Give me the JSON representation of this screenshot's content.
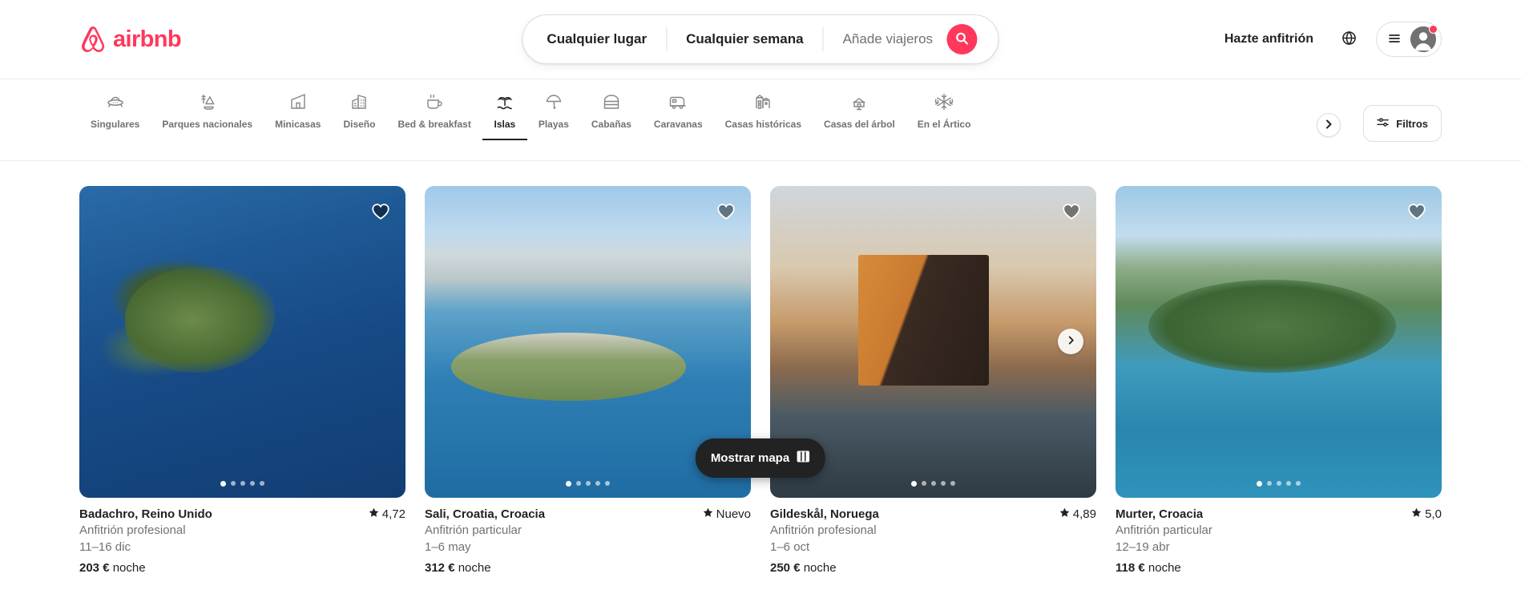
{
  "brand": {
    "name": "airbnb",
    "color": "#FF385C"
  },
  "search": {
    "place_label": "Cualquier lugar",
    "date_label": "Cualquier semana",
    "guests_placeholder": "Añade viajeros",
    "guests_value": "",
    "search_icon": "search-icon"
  },
  "header": {
    "host_link": "Hazte anfitrión",
    "globe_icon": "globe-icon",
    "menu_icon": "hamburger-menu-icon",
    "avatar_icon": "user-avatar-icon",
    "has_notification": true
  },
  "categories": {
    "items": [
      {
        "label": "Singulares",
        "icon": "ufo-icon",
        "active": false
      },
      {
        "label": "Parques nacionales",
        "icon": "national-park-icon",
        "active": false
      },
      {
        "label": "Minicasas",
        "icon": "tiny-house-icon",
        "active": false
      },
      {
        "label": "Diseño",
        "icon": "design-house-icon",
        "active": false
      },
      {
        "label": "Bed & breakfast",
        "icon": "coffee-cup-icon",
        "active": false
      },
      {
        "label": "Islas",
        "icon": "island-palm-icon",
        "active": true
      },
      {
        "label": "Playas",
        "icon": "beach-umbrella-icon",
        "active": false
      },
      {
        "label": "Cabañas",
        "icon": "cabin-icon",
        "active": false
      },
      {
        "label": "Caravanas",
        "icon": "camper-van-icon",
        "active": false
      },
      {
        "label": "Casas históricas",
        "icon": "historic-house-icon",
        "active": false
      },
      {
        "label": "Casas del árbol",
        "icon": "treehouse-icon",
        "active": false
      },
      {
        "label": "En el Ártico",
        "icon": "snowflake-icon",
        "active": false
      }
    ],
    "next_arrow_icon": "chevron-right-icon",
    "filters_label": "Filtros",
    "filters_icon": "filters-sliders-icon"
  },
  "listings": [
    {
      "title": "Badachro, Reino Unido",
      "rating": "4,72",
      "host_type": "Anfitrión profesional",
      "dates": "11–16 dic",
      "price_amount": "203 €",
      "price_unit": "noche",
      "dots_total": 5,
      "dots_active": 0,
      "favorite": false,
      "photo_alt": "aerial-view-island-house"
    },
    {
      "title": "Sali, Croatia, Croacia",
      "rating": "Nuevo",
      "host_type": "Anfitrión particular",
      "dates": "1–6 may",
      "price_amount": "312 €",
      "price_unit": "noche",
      "dots_total": 5,
      "dots_active": 0,
      "favorite": false,
      "photo_alt": "rocky-island-turquoise-sea"
    },
    {
      "title": "Gildeskål, Noruega",
      "rating": "4,89",
      "host_type": "Anfitrión profesional",
      "dates": "1–6 oct",
      "price_amount": "250 €",
      "price_unit": "noche",
      "dots_total": 5,
      "dots_active": 0,
      "favorite": false,
      "photo_alt": "modern-cabin-on-stilts-fjord"
    },
    {
      "title": "Murter, Croacia",
      "rating": "5,0",
      "host_type": "Anfitrión particular",
      "dates": "12–19 abr",
      "price_amount": "118 €",
      "price_unit": "noche",
      "dots_total": 5,
      "dots_active": 0,
      "favorite": false,
      "photo_alt": "coastal-island-pine-forest"
    }
  ],
  "map_button": {
    "label": "Mostrar mapa",
    "icon": "map-icon"
  }
}
